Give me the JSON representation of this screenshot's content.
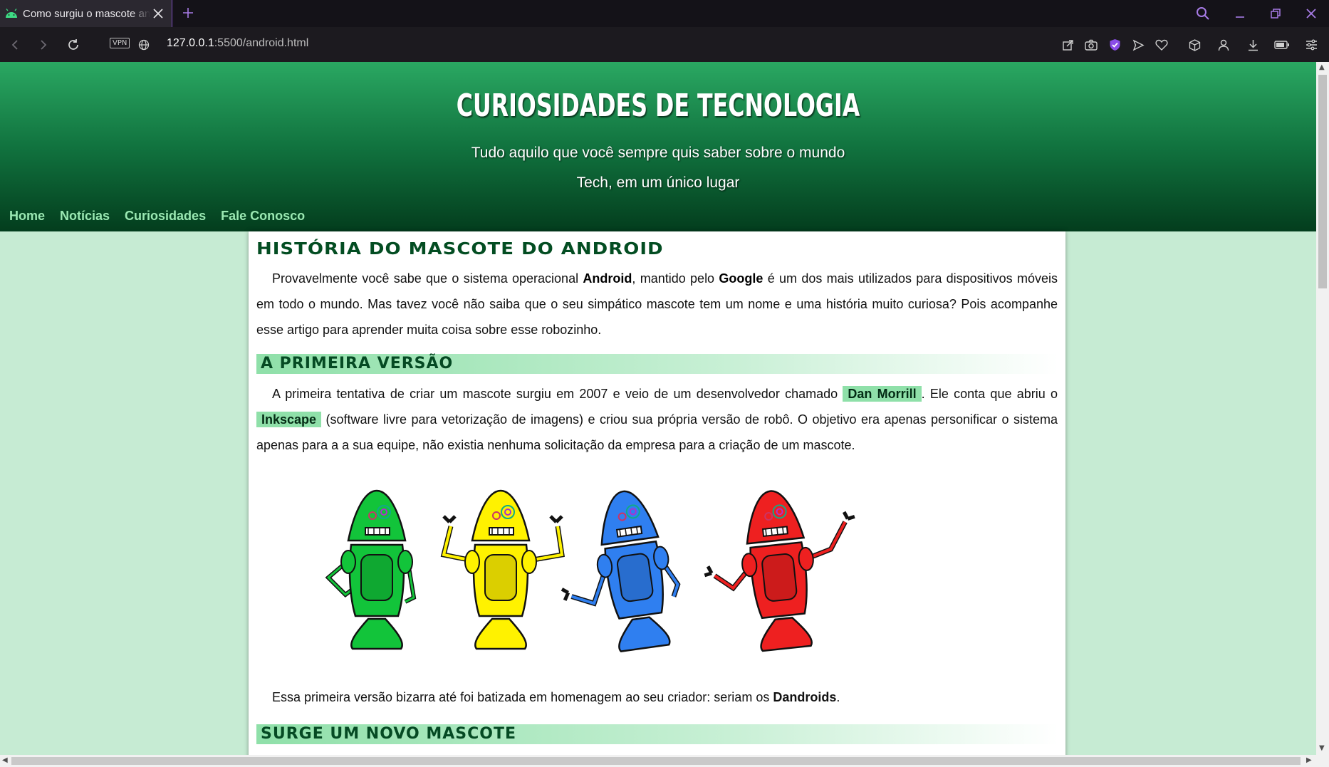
{
  "browser": {
    "tab_title": "Como surgiu o mascote an",
    "url_host": "127.0.0.1",
    "url_rest": ":5500/android.html",
    "vpn_label": "VPN",
    "accent_color": "#7c4dbf"
  },
  "site": {
    "title": "Curiosidades de Tecnologia",
    "subtitle": "Tudo aquilo que você sempre quis saber sobre o mundo Tech, em um único lugar",
    "nav": [
      "Home",
      "Notícias",
      "Curiosidades",
      "Fale Conosco"
    ],
    "colors": {
      "header_top": "#2aa862",
      "header_bottom": "#033d1d",
      "page_bg": "#c6ebd3",
      "highlight": "#8fe0a9"
    }
  },
  "article": {
    "title": "História do mascote do Android",
    "intro": {
      "t1": "Provavelmente você sabe que o sistema operacional ",
      "b1": "Android",
      "t2": ", mantido pelo ",
      "b2": "Google",
      "t3": " é um dos mais utilizados para dispositivos móveis em todo o mundo. Mas tavez você não saiba que o seu simpático mascote tem um nome e uma história muito curiosa? Pois acompanhe esse artigo para aprender muita coisa sobre esse robozinho."
    },
    "section1": {
      "heading": "A primeira versão",
      "t1": "A primeira tentativa de criar um mascote surgiu em 2007 e veio de um desenvolvedor chamado ",
      "hl1": "Dan Morrill",
      "t2": ". Ele conta que abriu o ",
      "hl2": "Inkscape",
      "t3": " (software livre para vetorização de imagens) e criou sua própria versão de robô. O objetivo era apenas personificar o sistema apenas para a a sua equipe, não existia nenhuma solicitação da empresa para a criação de um mascote.",
      "image_alt": "Dandroids illustration",
      "robot_colors": [
        "#12c43a",
        "#fff200",
        "#2f7ff0",
        "#ee2020"
      ],
      "t4": "Essa primeira versão bizarra até foi batizada em homenagem ao seu criador: seriam os ",
      "b4": "Dandroids",
      "t5": "."
    },
    "section2": {
      "heading": "Surge um novo mascote"
    }
  }
}
